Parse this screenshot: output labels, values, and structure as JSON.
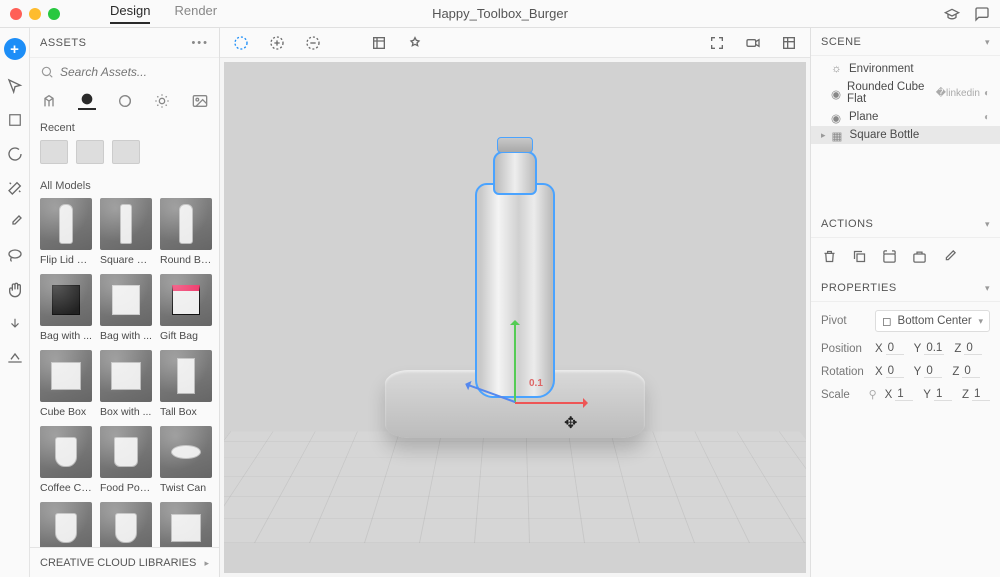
{
  "titlebar": {
    "tabs": {
      "design": "Design",
      "render": "Render"
    },
    "document": "Happy_Toolbox_Burger"
  },
  "assets": {
    "title": "ASSETS",
    "search_placeholder": "Search Assets...",
    "section_recent": "Recent",
    "section_all": "All Models",
    "models": [
      "Flip Lid B...",
      "Square B...",
      "Round Bo...",
      "Bag with ...",
      "Bag with ...",
      "Gift Bag",
      "Cube Box",
      "Box with ...",
      "Tall Box",
      "Coffee Cup",
      "Food Pou...",
      "Twist Can"
    ],
    "cc_label": "CREATIVE CLOUD LIBRARIES"
  },
  "scene": {
    "title": "SCENE",
    "items": [
      "Environment",
      "Rounded Cube Flat",
      "Plane",
      "Square Bottle"
    ]
  },
  "actions": {
    "title": "ACTIONS"
  },
  "properties": {
    "title": "PROPERTIES",
    "pivot_label": "Pivot",
    "pivot_value": "Bottom Center",
    "position_label": "Position",
    "rotation_label": "Rotation",
    "scale_label": "Scale",
    "position": {
      "x": "0",
      "y": "0.1",
      "z": "0"
    },
    "rotation": {
      "x": "0",
      "y": "0",
      "z": "0"
    },
    "scale": {
      "x": "1",
      "y": "1",
      "z": "1"
    },
    "axis": {
      "x": "X",
      "y": "Y",
      "z": "Z"
    }
  },
  "viewport": {
    "gizmo_label": "0.1"
  }
}
